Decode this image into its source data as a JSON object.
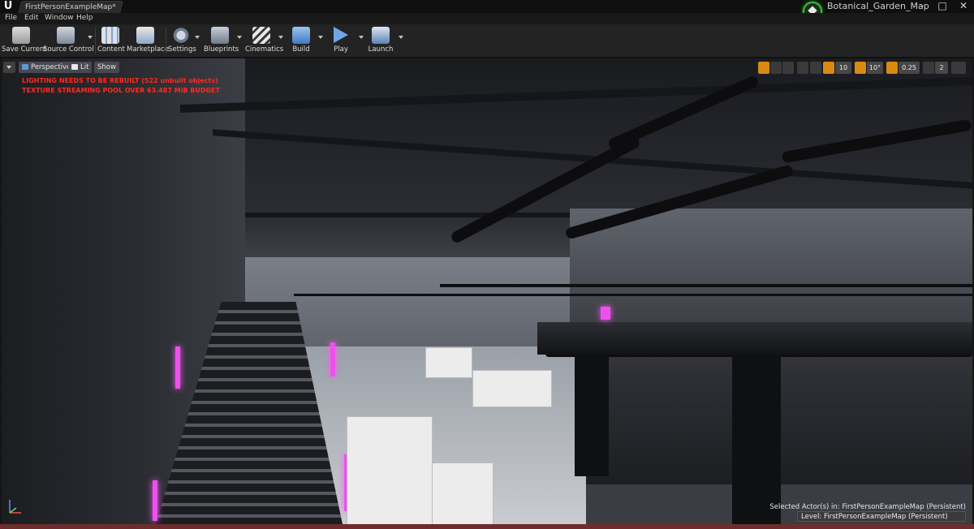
{
  "window": {
    "tab_title": "FirstPersonExampleMap*",
    "project_name": "Botanical_Garden_Map",
    "controls": [
      "–",
      "□",
      "✕"
    ]
  },
  "menu": [
    "File",
    "Edit",
    "Window",
    "Help"
  ],
  "toolbar": [
    {
      "label": "Save Current",
      "icon": "save-icon"
    },
    {
      "label": "Source Control",
      "icon": "source-control-icon"
    },
    {
      "label": "Content",
      "icon": "content-icon"
    },
    {
      "label": "Marketplace",
      "icon": "marketplace-icon"
    },
    {
      "label": "Settings",
      "icon": "settings-icon"
    },
    {
      "label": "Blueprints",
      "icon": "blueprints-icon"
    },
    {
      "label": "Cinematics",
      "icon": "cinematics-icon"
    },
    {
      "label": "Build",
      "icon": "build-icon"
    },
    {
      "label": "Play",
      "icon": "play-icon"
    },
    {
      "label": "Launch",
      "icon": "launch-icon"
    }
  ],
  "viewport": {
    "view_mode": "Perspective",
    "lighting_mode": "Lit",
    "show_label": "Show",
    "warnings": [
      "LIGHTING NEEDS TO BE REBUILT (522 unbuilt objects)",
      "TEXTURE STREAMING POOL OVER 63.487 MiB BUDGET"
    ],
    "grid_snap": "10",
    "rotation_snap": "10°",
    "scale_snap": "0.25",
    "camera_speed": "2",
    "selected_actors": "Selected Actor(s) in:  FirstPersonExampleMap (Persistent)",
    "level": "Level:  FirstPersonExampleMap (Persistent)"
  }
}
